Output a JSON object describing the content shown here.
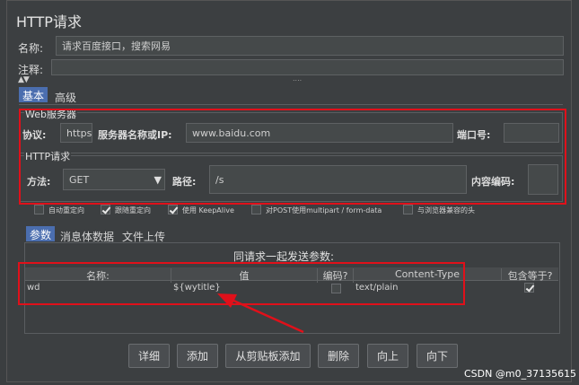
{
  "title": "HTTP请求",
  "name": {
    "label": "名称:",
    "value": "请求百度接口，搜索网易"
  },
  "comment": {
    "label": "注释:",
    "value": ""
  },
  "collapse_hint": "....",
  "tabs": [
    {
      "label": "基本",
      "active": true
    },
    {
      "label": "高级",
      "active": false
    }
  ],
  "web_server": {
    "legend": "Web服务器",
    "protocol_label": "协议:",
    "protocol_value": "https",
    "server_label": "服务器名称或IP:",
    "server_value": "www.baidu.com",
    "port_label": "端口号:",
    "port_value": ""
  },
  "http_request": {
    "legend": "HTTP请求",
    "method_label": "方法:",
    "method_value": "GET",
    "path_label": "路径:",
    "path_value": "/s",
    "encoding_label": "内容编码:",
    "encoding_value": ""
  },
  "options": [
    {
      "label": "自动重定向",
      "checked": false
    },
    {
      "label": "跟随重定向",
      "checked": true
    },
    {
      "label": "使用 KeepAlive",
      "checked": true
    },
    {
      "label": "对POST使用multipart / form-data",
      "checked": false
    },
    {
      "label": "与浏览器兼容的头",
      "checked": false
    }
  ],
  "sub_tabs": [
    {
      "label": "参数",
      "active": true
    },
    {
      "label": "消息体数据",
      "active": false
    },
    {
      "label": "文件上传",
      "active": false
    }
  ],
  "params": {
    "caption": "同请求一起发送参数:",
    "columns": [
      "名称:",
      "值",
      "编码?",
      "Content-Type",
      "包含等于?"
    ],
    "rows": [
      {
        "name": "wd",
        "value": "${wytitle}",
        "encode": false,
        "content_type": "text/plain",
        "include_equals": true
      }
    ]
  },
  "buttons": [
    "详细",
    "添加",
    "从剪贴板添加",
    "删除",
    "向上",
    "向下"
  ],
  "watermark": "CSDN @m0_37135615",
  "colors": {
    "highlight": "#e0101a",
    "tab_active": "#4b6eaf",
    "background": "#3c3f41"
  }
}
